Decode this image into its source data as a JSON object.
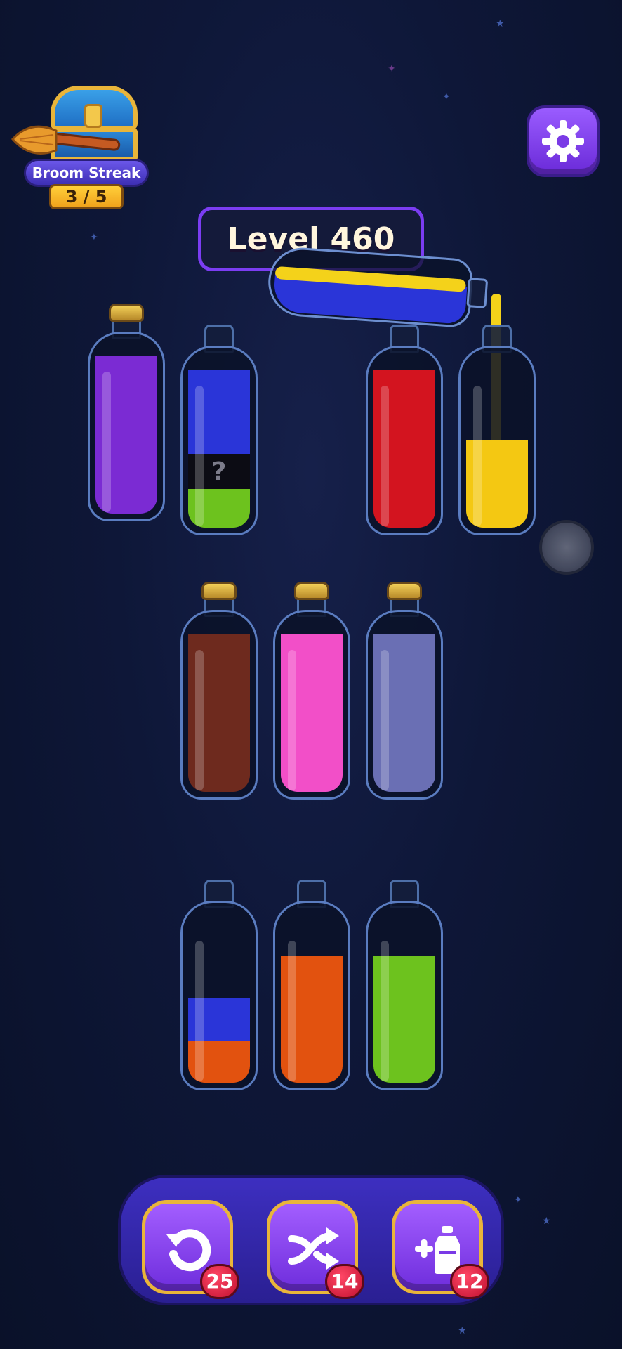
{
  "streak": {
    "title": "Broom Streak",
    "count": "3 / 5"
  },
  "level": {
    "label": "Level 460"
  },
  "colors": {
    "purple": "#7b2bd3",
    "blue": "#2a35d8",
    "mystery": "#0c0c14",
    "green": "#6dc21e",
    "red": "#d3141f",
    "yellow": "#f4c812",
    "brown": "#6e2a1e",
    "pink": "#f24fc8",
    "lavender": "#6a6fb4",
    "orange": "#e2520f"
  },
  "bottles": [
    {
      "name": "bottle-1",
      "corked": true,
      "layers": [
        {
          "color": "#7b2bd3",
          "fraction": 0.9
        }
      ]
    },
    {
      "name": "bottle-2",
      "corked": false,
      "layers": [
        {
          "color": "#6dc21e",
          "fraction": 0.22
        },
        {
          "color": "#0c0c14",
          "fraction": 0.2,
          "label": "?"
        },
        {
          "color": "#2a35d8",
          "fraction": 0.48
        }
      ]
    },
    {
      "name": "bottle-3",
      "corked": false,
      "layers": [
        {
          "color": "#d3141f",
          "fraction": 0.9
        }
      ]
    },
    {
      "name": "bottle-4",
      "corked": false,
      "layers": [
        {
          "color": "#f4c812",
          "fraction": 0.5
        }
      ]
    },
    {
      "name": "bottle-5",
      "corked": true,
      "layers": [
        {
          "color": "#6e2a1e",
          "fraction": 0.9
        }
      ]
    },
    {
      "name": "bottle-6",
      "corked": true,
      "layers": [
        {
          "color": "#f24fc8",
          "fraction": 0.9
        }
      ]
    },
    {
      "name": "bottle-7",
      "corked": true,
      "layers": [
        {
          "color": "#6a6fb4",
          "fraction": 0.9
        }
      ]
    },
    {
      "name": "bottle-8",
      "corked": false,
      "layers": [
        {
          "color": "#e2520f",
          "fraction": 0.24
        },
        {
          "color": "#2a35d8",
          "fraction": 0.24
        }
      ]
    },
    {
      "name": "bottle-9",
      "corked": false,
      "layers": [
        {
          "color": "#e2520f",
          "fraction": 0.72
        }
      ]
    },
    {
      "name": "bottle-10",
      "corked": false,
      "layers": [
        {
          "color": "#6dc21e",
          "fraction": 0.72
        }
      ]
    }
  ],
  "tools": [
    {
      "name": "undo-button",
      "icon": "undo-icon",
      "count": "25"
    },
    {
      "name": "shuffle-button",
      "icon": "shuffle-icon",
      "count": "14"
    },
    {
      "name": "add-bottle-button",
      "icon": "add-bottle-icon",
      "count": "12"
    }
  ]
}
